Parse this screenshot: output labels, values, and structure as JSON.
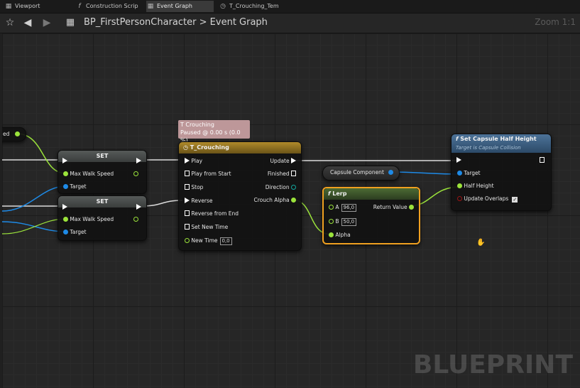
{
  "tabs": [
    {
      "label": "Viewport",
      "icon": "viewport-icon"
    },
    {
      "label": "Construction Scrip",
      "icon": "function-icon"
    },
    {
      "label": "Event Graph",
      "icon": "event-graph-icon"
    },
    {
      "label": "T_Crouching_Tem",
      "icon": "timeline-icon"
    }
  ],
  "toolbar": {
    "breadcrumb_blueprint": "BP_FirstPersonCharacter",
    "breadcrumb_separator": ">",
    "breadcrumb_graph": "Event Graph",
    "zoom": "Zoom 1:1"
  },
  "colors": {
    "exec": "#ffffff",
    "float_pin": "#9be33b",
    "object_pin": "#1e8ae6",
    "bool_pin": "#9a1515",
    "timeline_header": "#a0761e",
    "pure_header": "#4c6b34",
    "function_header": "#3a5f8a",
    "selection": "#f0a020"
  },
  "graph": {
    "left_stub_label": "ed",
    "set_node_1": {
      "title": "SET",
      "pin_speed": "Max Walk Speed",
      "pin_target": "Target"
    },
    "set_node_2": {
      "title": "SET",
      "pin_speed": "Max Walk Speed",
      "pin_target": "Target"
    },
    "timeline_tooltip": {
      "line1": "T Crouching",
      "line2": "Paused @ 0.00 s (0.0 %)"
    },
    "timeline": {
      "title": "T_Crouching",
      "inputs": [
        "Play",
        "Play from Start",
        "Stop",
        "Reverse",
        "Reverse from End",
        "Set New Time"
      ],
      "new_time_label": "New Time",
      "new_time_value": "0,0",
      "out_update": "Update",
      "out_finished": "Finished",
      "out_direction": "Direction",
      "out_alpha": "Crouch Alpha"
    },
    "capsule_getter": "Capsule Component",
    "lerp": {
      "title": "Lerp",
      "pin_a": "A",
      "a_value": "96,0",
      "pin_b": "B",
      "b_value": "50,0",
      "pin_alpha": "Alpha",
      "out": "Return Value"
    },
    "set_capsule": {
      "title": "Set Capsule Half Height",
      "subtitle": "Target is Capsule Collision",
      "pin_target": "Target",
      "pin_half_height": "Half Height",
      "pin_update_overlaps": "Update Overlaps",
      "update_overlaps_checked": true
    }
  },
  "watermark": "BLUEPRINT"
}
